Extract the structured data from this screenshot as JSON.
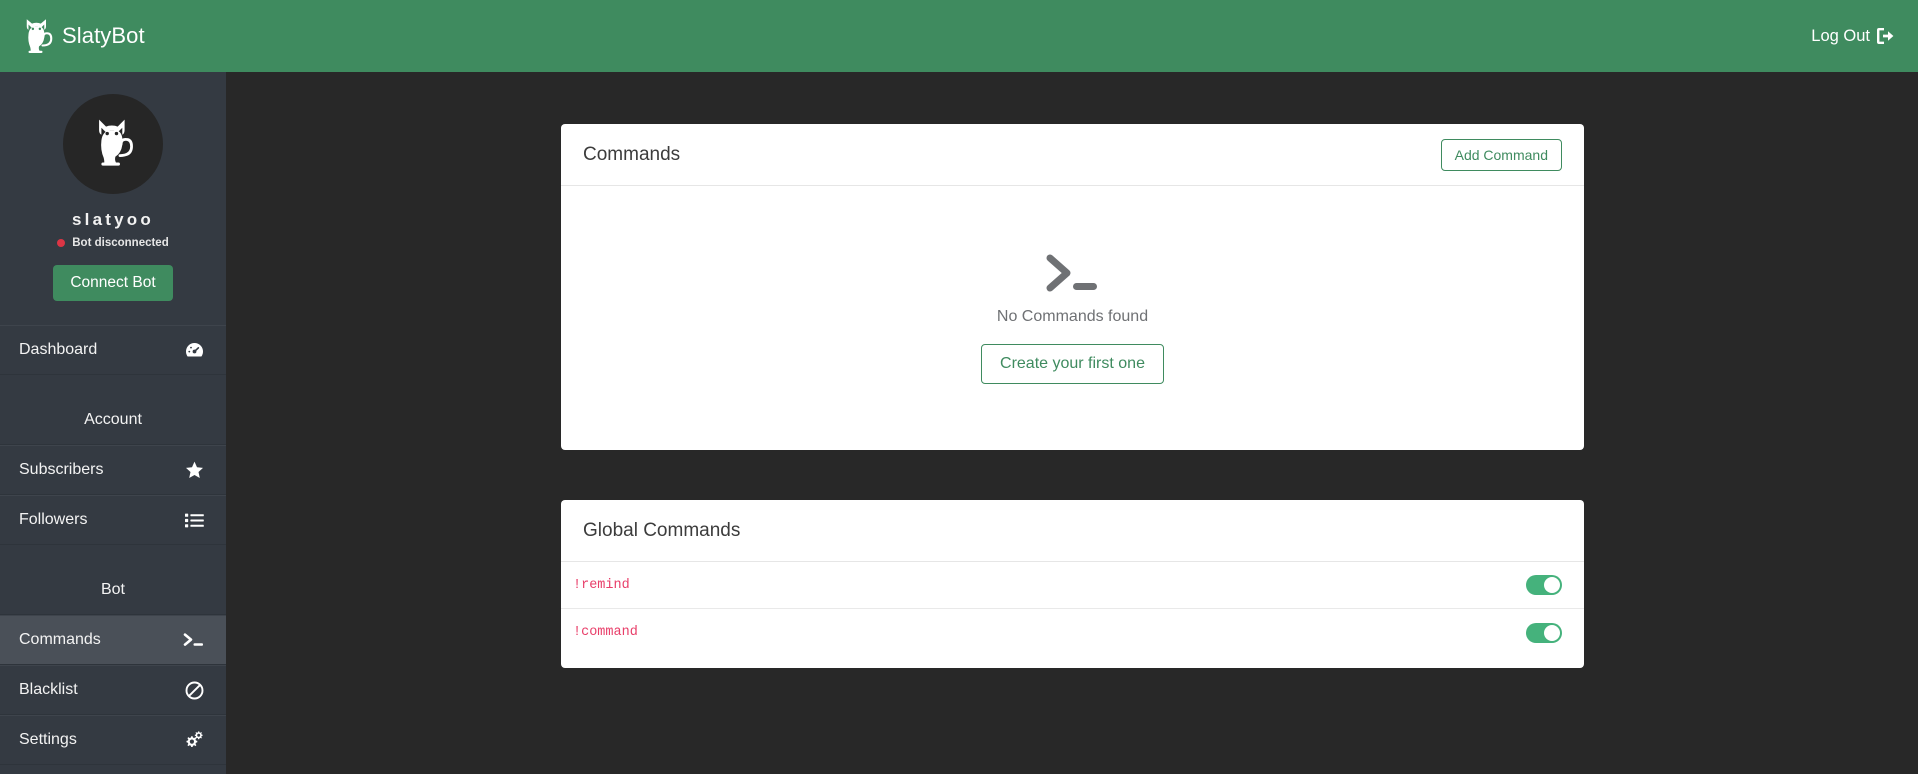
{
  "navbar": {
    "brand": "SlatyBot",
    "brand_icon": "cat-logo-icon",
    "logout_label": "Log Out",
    "logout_icon": "sign-out-icon",
    "background_color": "#3f8b5f"
  },
  "sidebar": {
    "avatar_icon": "cat-avatar-icon",
    "profile_name": "slatyoo",
    "status_text": "Bot disconnected",
    "status_color": "#dc3545",
    "connect_button": "Connect Bot",
    "items": [
      {
        "label": "Dashboard",
        "icon": "tachometer-icon",
        "active": false
      },
      {
        "label": "Account",
        "type": "heading"
      },
      {
        "label": "Subscribers",
        "icon": "star-icon",
        "active": false
      },
      {
        "label": "Followers",
        "icon": "list-icon",
        "active": false
      },
      {
        "label": "Bot",
        "type": "heading"
      },
      {
        "label": "Commands",
        "icon": "terminal-icon",
        "active": true
      },
      {
        "label": "Blacklist",
        "icon": "ban-icon",
        "active": false
      },
      {
        "label": "Settings",
        "icon": "cogs-icon",
        "active": false
      }
    ],
    "background_color": "#343a42",
    "active_color": "#4a5058"
  },
  "main": {
    "commands_card": {
      "title": "Commands",
      "add_button": "Add Command",
      "empty_icon": "terminal-prompt-icon",
      "empty_text": "No Commands found",
      "create_button": "Create your first one"
    },
    "global_card": {
      "title": "Global Commands",
      "rows": [
        {
          "name": "!remind",
          "enabled": true
        },
        {
          "name": "!command",
          "enabled": true
        }
      ],
      "command_color": "#e83e69",
      "toggle_on_color": "#45b27c"
    },
    "background_color": "#282828"
  }
}
